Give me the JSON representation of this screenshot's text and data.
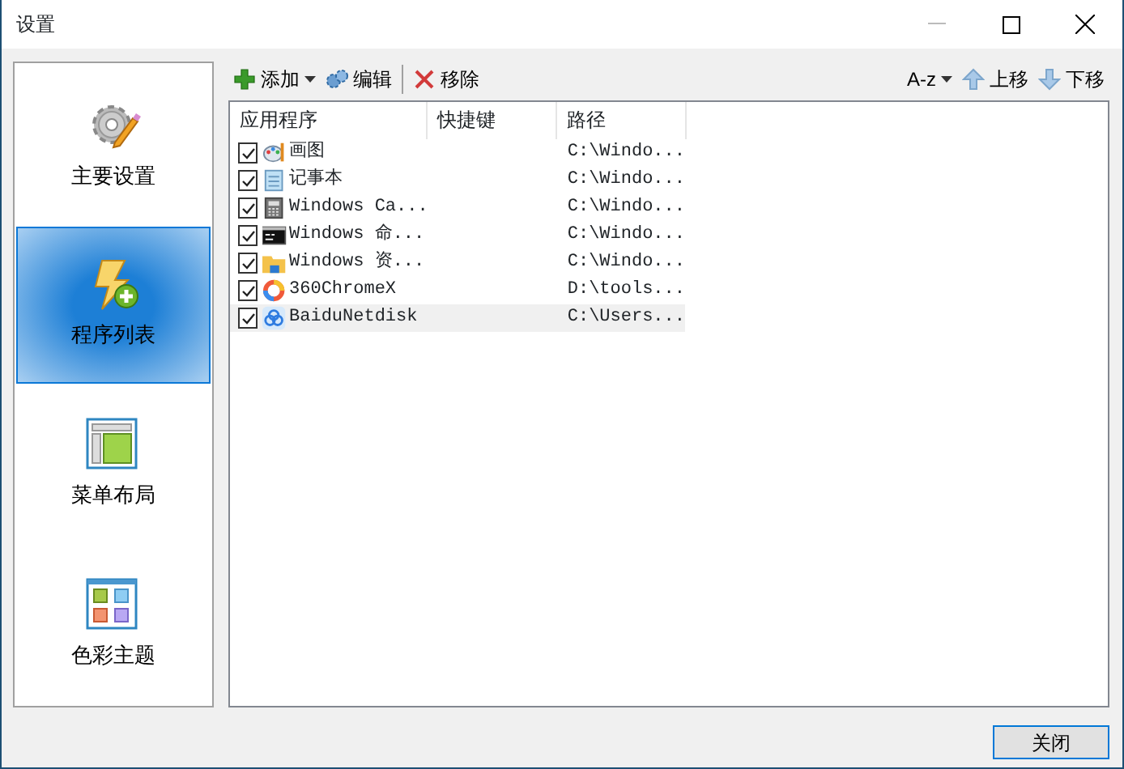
{
  "window": {
    "title": "设置"
  },
  "sidebar": {
    "items": [
      {
        "label": "主要设置",
        "selected": false
      },
      {
        "label": "程序列表",
        "selected": true
      },
      {
        "label": "菜单布局",
        "selected": false
      },
      {
        "label": "色彩主题",
        "selected": false
      }
    ]
  },
  "toolbar": {
    "left": [
      {
        "label": "添加",
        "dropdown": true
      },
      {
        "label": "编辑",
        "dropdown": false
      },
      {
        "label": "移除",
        "dropdown": false
      }
    ],
    "right": [
      {
        "label": "A-z",
        "dropdown": true
      },
      {
        "label": "上移",
        "dropdown": false
      },
      {
        "label": "下移",
        "dropdown": false
      }
    ]
  },
  "table": {
    "columns": [
      "应用程序",
      "快捷键",
      "路径"
    ],
    "rows": [
      {
        "checked": true,
        "app": "画图",
        "path": "C:\\Windo...",
        "selected": false
      },
      {
        "checked": true,
        "app": "记事本",
        "path": "C:\\Windo...",
        "selected": false
      },
      {
        "checked": true,
        "app": "Windows Ca...",
        "path": "C:\\Windo...",
        "selected": false
      },
      {
        "checked": true,
        "app": "Windows 命...",
        "path": "C:\\Windo...",
        "selected": false
      },
      {
        "checked": true,
        "app": "Windows 资...",
        "path": "C:\\Windo...",
        "selected": false
      },
      {
        "checked": true,
        "app": "360ChromeX",
        "path": "D:\\tools...",
        "selected": false
      },
      {
        "checked": true,
        "app": "BaiduNetdisk",
        "path": "C:\\Users...",
        "selected": true
      }
    ]
  },
  "buttons": [
    {
      "label": "关闭"
    }
  ]
}
